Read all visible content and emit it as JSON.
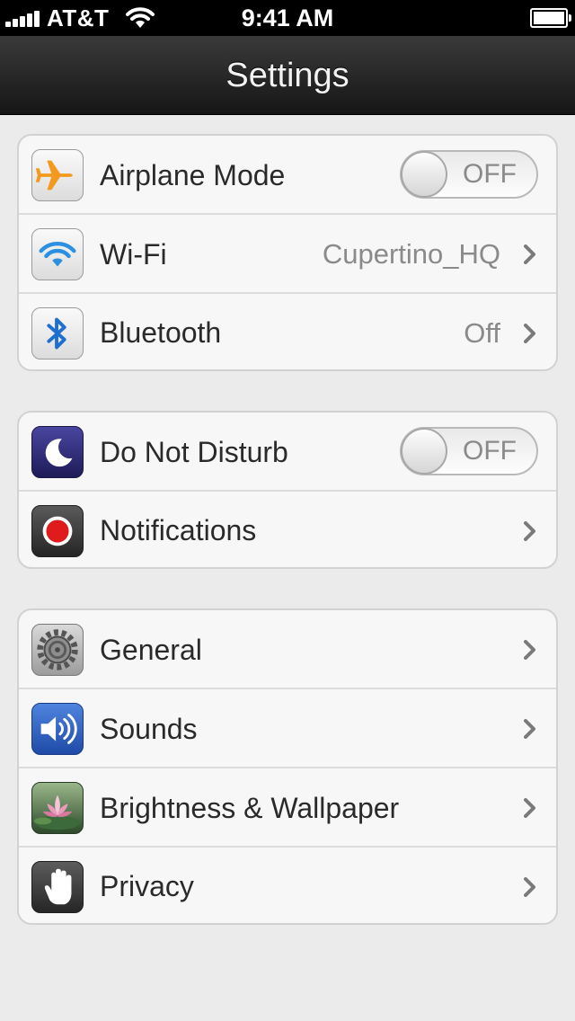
{
  "status_bar": {
    "carrier": "AT&T",
    "time": "9:41 AM",
    "signal_bars": 5,
    "battery_level": 1.0
  },
  "nav": {
    "title": "Settings"
  },
  "groups": [
    {
      "rows": [
        {
          "label": "Airplane Mode",
          "icon": "airplane-icon",
          "toggle": "OFF"
        },
        {
          "label": "Wi-Fi",
          "icon": "wifi-icon",
          "value": "Cupertino_HQ"
        },
        {
          "label": "Bluetooth",
          "icon": "bluetooth-icon",
          "value": "Off"
        }
      ]
    },
    {
      "rows": [
        {
          "label": "Do Not Disturb",
          "icon": "moon-icon",
          "toggle": "OFF"
        },
        {
          "label": "Notifications",
          "icon": "notifications-icon"
        }
      ]
    },
    {
      "rows": [
        {
          "label": "General",
          "icon": "gear-icon"
        },
        {
          "label": "Sounds",
          "icon": "speaker-icon"
        },
        {
          "label": "Brightness & Wallpaper",
          "icon": "lotus-icon"
        },
        {
          "label": "Privacy",
          "icon": "hand-icon"
        }
      ]
    }
  ],
  "colors": {
    "airplane_orange": "#f39a1e",
    "wifi_blue": "#2c8fe0",
    "bluetooth_blue": "#1e6fd0",
    "dnd_purple": "#2d2a72",
    "notification_red": "#e01b1b",
    "sounds_blue": "#2b5fc0"
  }
}
